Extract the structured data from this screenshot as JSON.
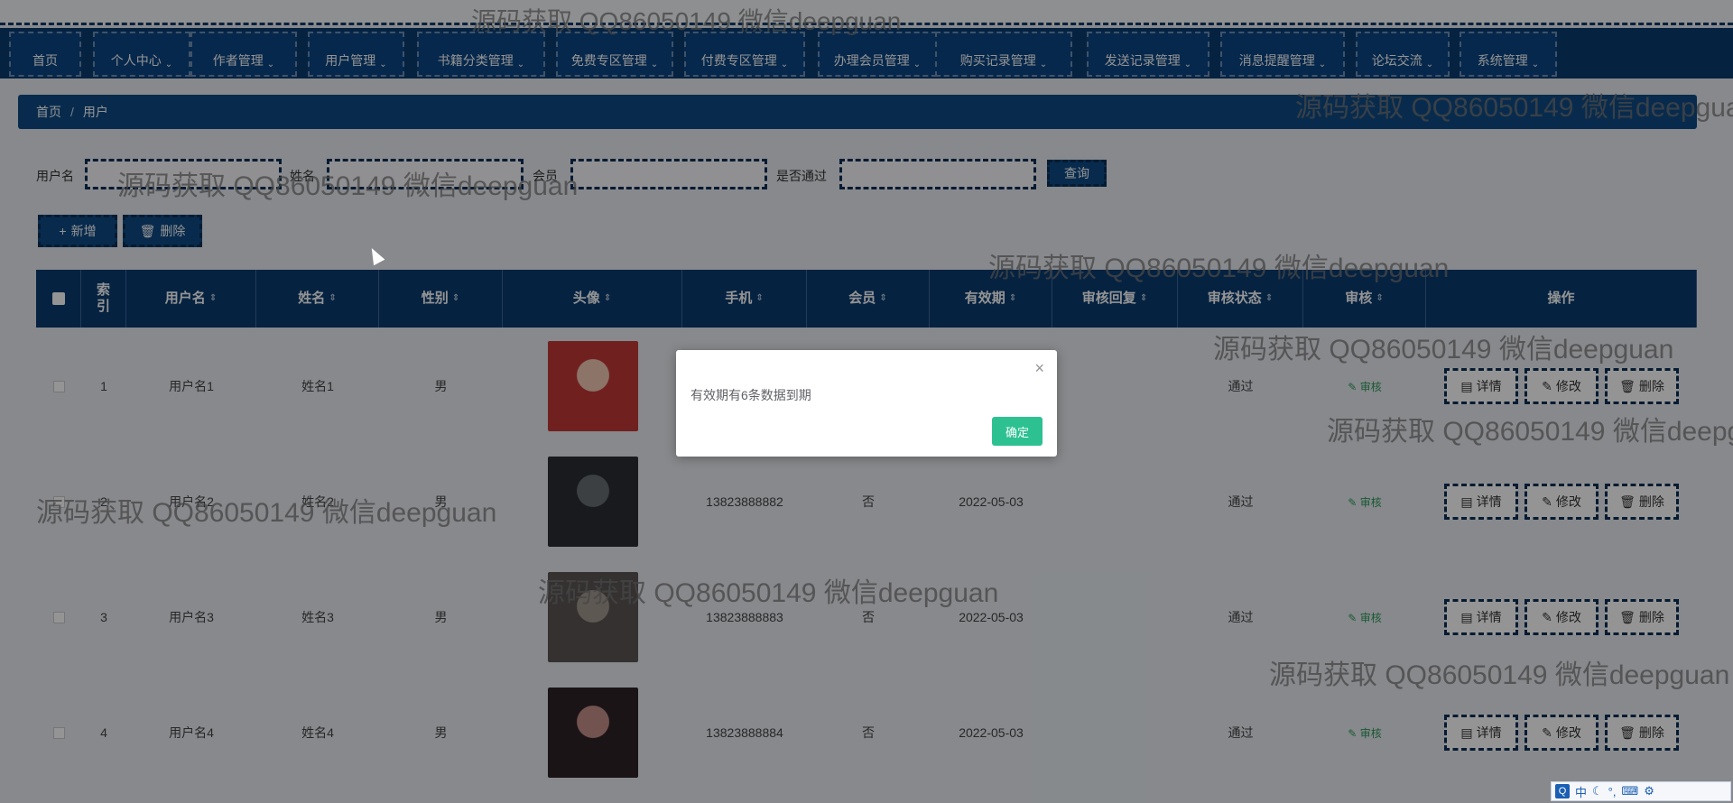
{
  "topbar": {
    "right_text": ""
  },
  "nav": {
    "items": [
      {
        "label": "首页",
        "has_menu": false
      },
      {
        "label": "个人中心",
        "has_menu": true
      },
      {
        "label": "作者管理",
        "has_menu": true
      },
      {
        "label": "用户管理",
        "has_menu": true
      },
      {
        "label": "书籍分类管理",
        "has_menu": true
      },
      {
        "label": "免费专区管理",
        "has_menu": true
      },
      {
        "label": "付费专区管理",
        "has_menu": true
      },
      {
        "label": "办理会员管理",
        "has_menu": true
      },
      {
        "label": "购买记录管理",
        "has_menu": true
      },
      {
        "label": "发送记录管理",
        "has_menu": true
      },
      {
        "label": "消息提醒管理",
        "has_menu": true
      },
      {
        "label": "论坛交流",
        "has_menu": true
      },
      {
        "label": "系统管理",
        "has_menu": true
      }
    ]
  },
  "breadcrumb": {
    "home": "首页",
    "current": "用户"
  },
  "filters": {
    "username_label": "用户名",
    "name_label": "姓名",
    "member_label": "会员",
    "approved_label": "是否通过",
    "query_button": "查询"
  },
  "actions": {
    "add": "新增",
    "delete": "删除"
  },
  "table": {
    "headers": [
      "索引",
      "用户名",
      "姓名",
      "性别",
      "头像",
      "手机",
      "会员",
      "有效期",
      "审核回复",
      "审核状态",
      "审核",
      "操作"
    ],
    "rows": [
      {
        "index": "1",
        "username": "用户名1",
        "name": "姓名1",
        "gender": "男",
        "phone": "",
        "member": "",
        "expiry": "",
        "reply": "",
        "status": "通过",
        "audit": "审核"
      },
      {
        "index": "2",
        "username": "用户名2",
        "name": "姓名2",
        "gender": "男",
        "phone": "13823888882",
        "member": "否",
        "expiry": "2022-05-03",
        "reply": "",
        "status": "通过",
        "audit": "审核"
      },
      {
        "index": "3",
        "username": "用户名3",
        "name": "姓名3",
        "gender": "男",
        "phone": "13823888883",
        "member": "否",
        "expiry": "2022-05-03",
        "reply": "",
        "status": "通过",
        "audit": "审核"
      },
      {
        "index": "4",
        "username": "用户名4",
        "name": "姓名4",
        "gender": "男",
        "phone": "13823888884",
        "member": "否",
        "expiry": "2022-05-03",
        "reply": "",
        "status": "通过",
        "audit": "审核"
      }
    ],
    "op_buttons": {
      "detail": "详情",
      "edit": "修改",
      "delete": "删除"
    }
  },
  "modal": {
    "message": "有效期有6条数据到期",
    "ok": "确定",
    "close": "×"
  },
  "watermark": {
    "text": "源码获取 QQ86050149 微信deepguan"
  },
  "ime": {
    "q": "Q",
    "lang": "中"
  },
  "colors": {
    "nav_bg": "#0a3b70",
    "confirm": "#2dc192",
    "audit_green": "#2e9a5a"
  }
}
